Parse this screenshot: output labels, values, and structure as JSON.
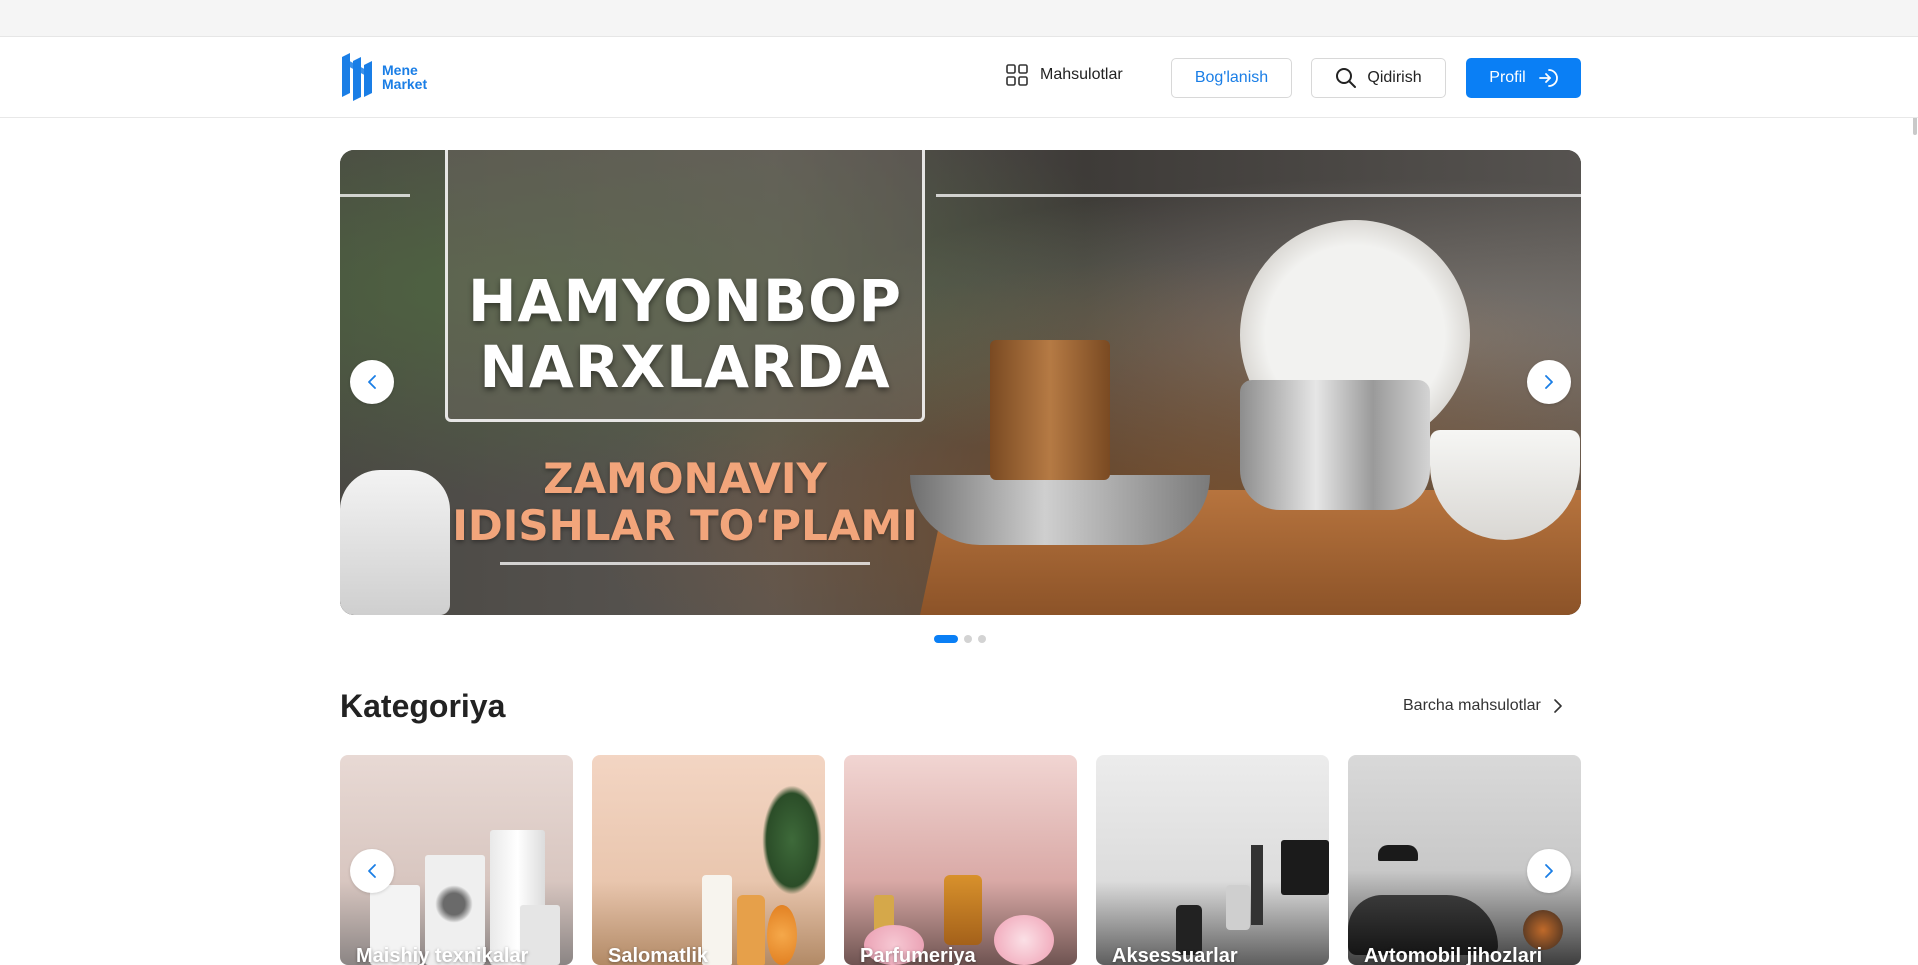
{
  "brand": {
    "line1": "Mene",
    "line2": "Market",
    "color": "#1a7ee6"
  },
  "nav": {
    "products_label": "Mahsulotlar",
    "contact_label": "Bog'lanish",
    "search_label": "Qidirish",
    "profile_label": "Profil"
  },
  "banner": {
    "title_line1": "HAMYONBOP",
    "title_line2": "NARXLARDA",
    "subtitle_line1": "ZAMONAVIY",
    "subtitle_line2": "IDISHLAR TO‘PLAMI",
    "active_slide": 1,
    "slide_count": 3
  },
  "categories": {
    "title": "Kategoriya",
    "all_link": "Barcha mahsulotlar",
    "items": [
      {
        "label": "Maishiy texnikalar"
      },
      {
        "label": "Salomatlik"
      },
      {
        "label": "Parfumeriya"
      },
      {
        "label": "Aksessuarlar"
      },
      {
        "label": "Avtomobil jihozlari"
      }
    ]
  },
  "colors": {
    "accent": "#0a7ff5",
    "subtitle": "#f2a57b"
  },
  "icons": {
    "products": "grid-icon",
    "search": "search-icon",
    "profile": "login-icon",
    "prev": "chevron-left-icon",
    "next": "chevron-right-icon"
  }
}
